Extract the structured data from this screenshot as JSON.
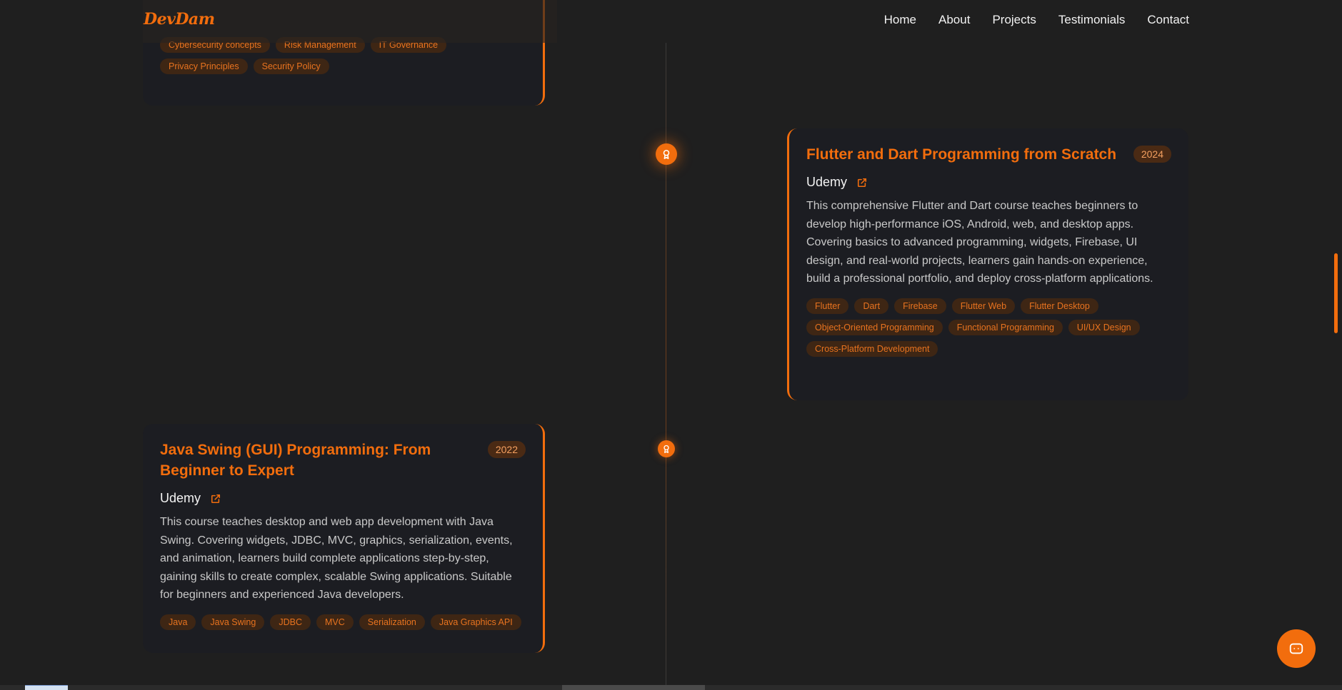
{
  "header": {
    "logo": "DevDam",
    "nav": [
      "Home",
      "About",
      "Projects",
      "Testimonials",
      "Contact"
    ]
  },
  "cards": {
    "top": {
      "tags": [
        "Cybersecurity concepts",
        "Risk Management",
        "IT Governance",
        "Privacy Principles",
        "Security Policy"
      ]
    },
    "flutter": {
      "title": "Flutter and Dart Programming from Scratch",
      "year": "2024",
      "issuer": "Udemy",
      "description": "This comprehensive Flutter and Dart course teaches beginners to develop high-performance iOS, Android, web, and desktop apps. Covering basics to advanced programming, widgets, Firebase, UI design, and real-world projects, learners gain hands-on experience, build a professional portfolio, and deploy cross-platform applications.",
      "tags": [
        "Flutter",
        "Dart",
        "Firebase",
        "Flutter Web",
        "Flutter Desktop",
        "Object-Oriented Programming",
        "Functional Programming",
        "UI/UX Design",
        "Cross-Platform Development"
      ]
    },
    "java": {
      "title": "Java Swing (GUI) Programming: From Beginner to Expert",
      "year": "2022",
      "issuer": "Udemy",
      "description": "This course teaches desktop and web app development with Java Swing. Covering widgets, JDBC, MVC, graphics, serialization, events, and animation, learners build complete applications step-by-step, gaining skills to create complex, scalable Swing applications. Suitable for beginners and experienced Java developers.",
      "tags": [
        "Java",
        "Java Swing",
        "JDBC",
        "MVC",
        "Serialization",
        "Java Graphics API"
      ]
    }
  },
  "colors": {
    "accent": "#f26d0d",
    "background": "#1f1f1f",
    "card": "#1c1d22"
  },
  "icons": {
    "timeline_node": "award-icon",
    "issuer_link": "external-link-icon",
    "fab": "chat-bot-icon"
  }
}
